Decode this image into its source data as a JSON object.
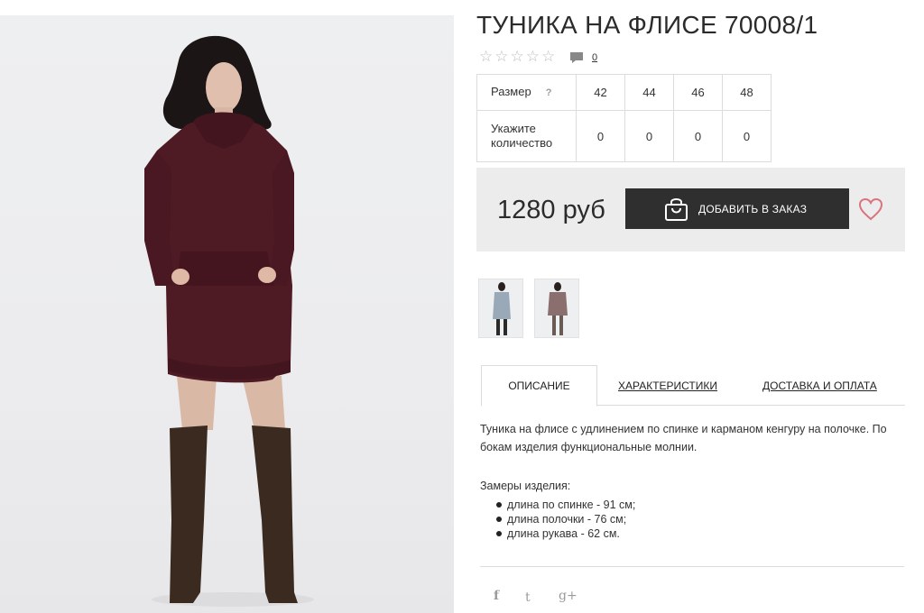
{
  "product": {
    "title": "ТУНИКА НА ФЛИСЕ 70008/1",
    "rating_stars": 0,
    "rating_max": 5,
    "comments_count": "0",
    "price": "1280 руб",
    "add_to_cart_label": "ДОБАВИТЬ В ЗАКАЗ"
  },
  "size_table": {
    "size_label": "Размер",
    "size_help": "?",
    "qty_label": "Укажите количество",
    "sizes": [
      "42",
      "44",
      "46",
      "48"
    ],
    "quantities": [
      "0",
      "0",
      "0",
      "0"
    ]
  },
  "tabs": [
    {
      "label": "ОПИСАНИЕ",
      "active": true
    },
    {
      "label": "ХАРАКТЕРИСТИКИ",
      "active": false
    },
    {
      "label": "ДОСТАВКА И ОПЛАТА",
      "active": false
    }
  ],
  "description": {
    "text": "Туника на флисе с удлинением по спинке и карманом кенгуру на полочке. По бокам изделия функциональные молнии.",
    "measures_title": "Замеры изделия:",
    "measures": [
      "длина по спинке - 91 см;",
      "длина полочки - 76 см;",
      "длина рукава - 62 см."
    ]
  },
  "social": {
    "facebook": "f",
    "twitter": "t",
    "googleplus": "g+"
  },
  "colors": {
    "tunic": "#4e1a24",
    "boots": "#3b2a20",
    "button": "#2f2f2f",
    "price_box": "#ececec",
    "heart": "#d9737d"
  }
}
